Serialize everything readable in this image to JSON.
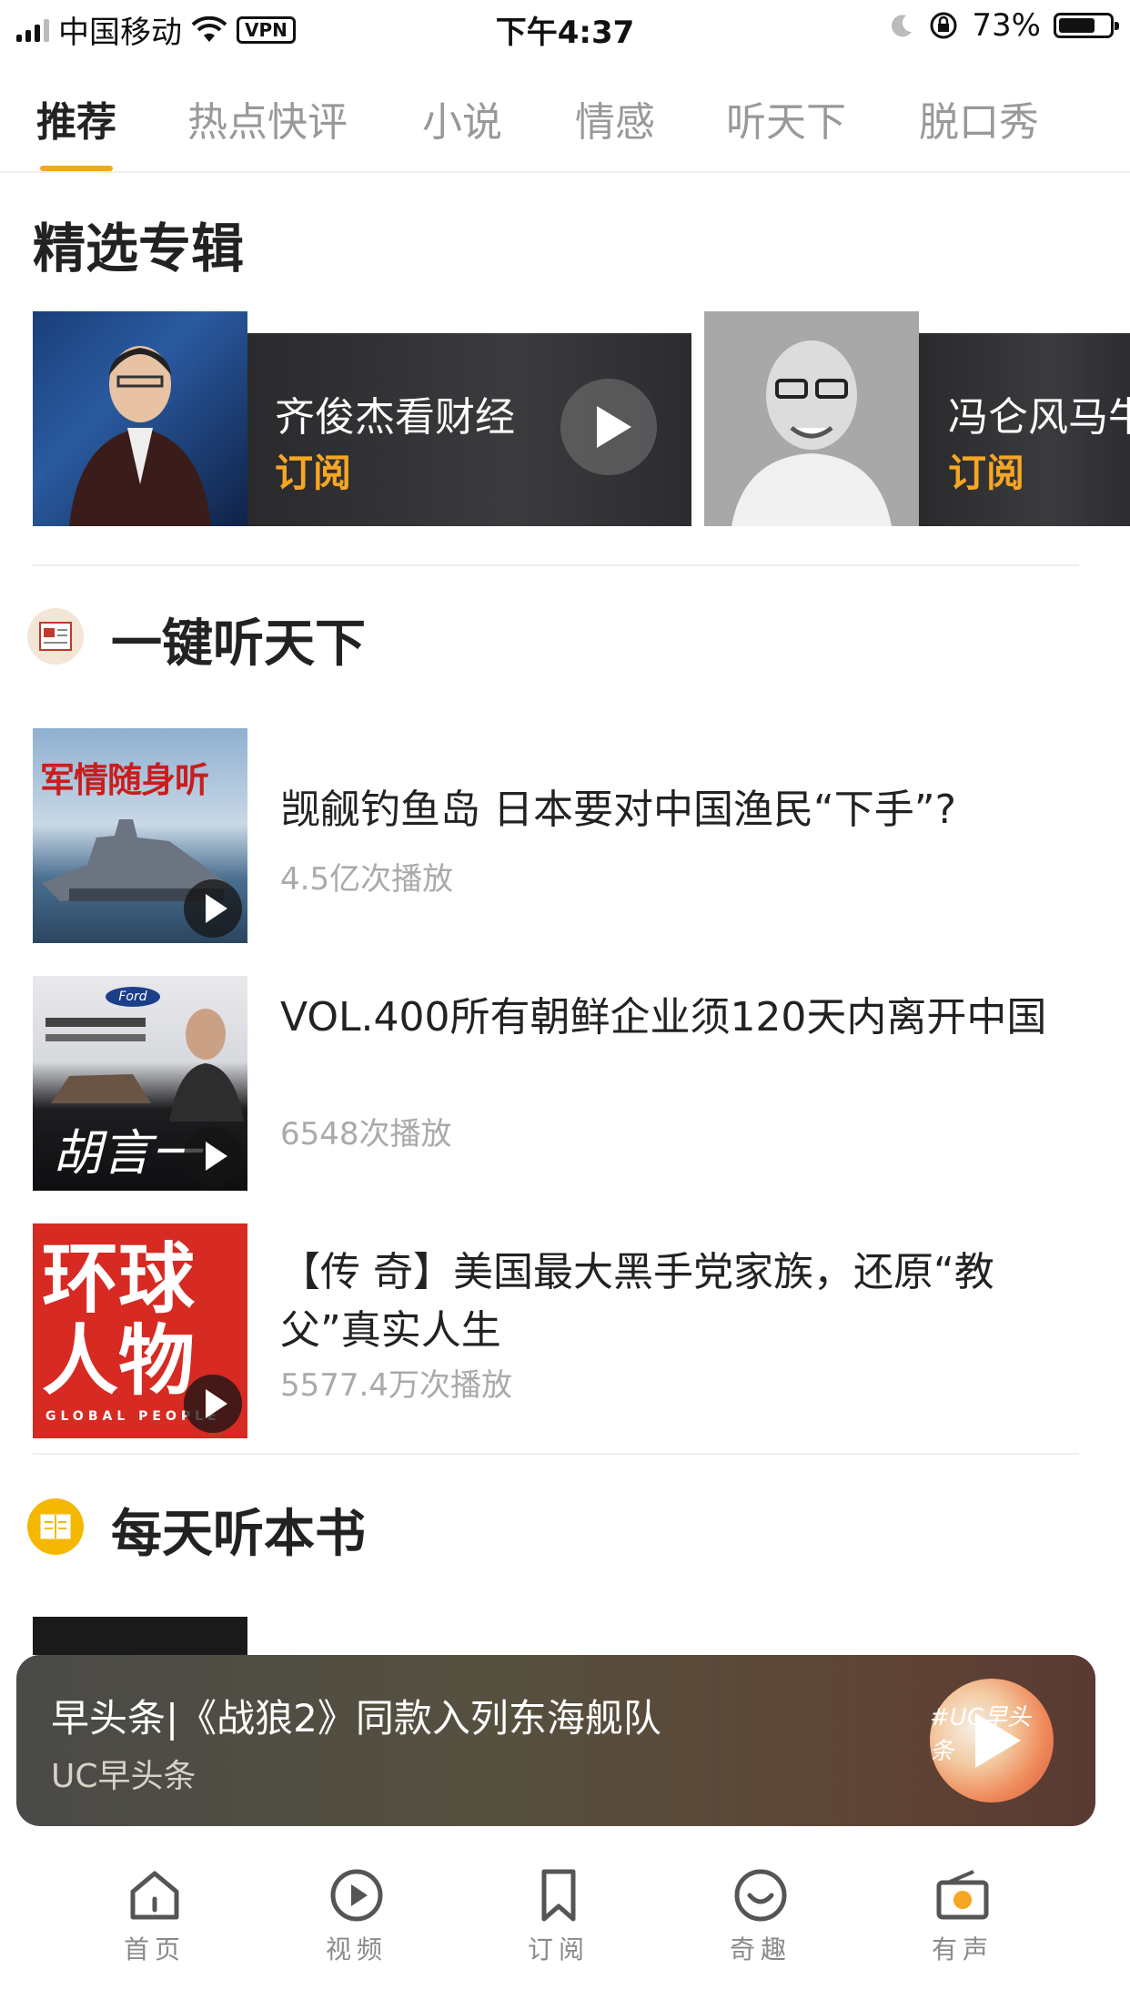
{
  "status_bar": {
    "carrier": "中国移动",
    "vpn": "VPN",
    "time": "下午4:37",
    "battery_pct": "73%",
    "battery_level": 0.73
  },
  "tabs": [
    {
      "label": "推荐",
      "active": true
    },
    {
      "label": "热点快评",
      "active": false
    },
    {
      "label": "小说",
      "active": false
    },
    {
      "label": "情感",
      "active": false
    },
    {
      "label": "听天下",
      "active": false
    },
    {
      "label": "脱口秀",
      "active": false
    }
  ],
  "featured": {
    "title": "精选专辑",
    "albums": [
      {
        "name": "齐俊杰看财经",
        "action": "订阅"
      },
      {
        "name": "冯仑风马牛",
        "action": "订阅"
      }
    ]
  },
  "listen_world": {
    "title": "一键听天下",
    "items": [
      {
        "thumb_text": "军情随身听",
        "title": "觊觎钓鱼岛 日本要对中国渔民“下手”?",
        "plays": "4.5亿次播放"
      },
      {
        "thumb_text": "胡言一一",
        "title": "VOL.400所有朝鲜企业须120天内离开中国",
        "plays": "6548次播放"
      },
      {
        "thumb_text": "环球人物",
        "thumb_sub": "GLOBAL PEOPLE",
        "title": "【传 奇】美国最大黑手党家族，还原“教父”真实人生",
        "plays": "5577.4万次播放"
      }
    ]
  },
  "daily_book": {
    "title": "每天听本书"
  },
  "player": {
    "title": "早头条|《战狼2》同款入列东海舰队",
    "source": "UC早头条",
    "cover_text": "#UC早头条"
  },
  "bottom_nav": [
    {
      "label": "首页",
      "icon": "home-icon"
    },
    {
      "label": "视频",
      "icon": "video-play-icon"
    },
    {
      "label": "订阅",
      "icon": "bookmark-icon"
    },
    {
      "label": "奇趣",
      "icon": "smile-icon"
    },
    {
      "label": "有声",
      "icon": "radio-icon"
    }
  ],
  "colors": {
    "accent": "#f5a623",
    "player_bg": "#55493c"
  }
}
